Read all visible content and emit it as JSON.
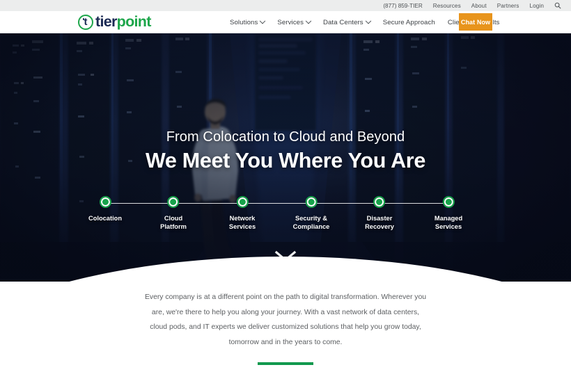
{
  "utility": {
    "phone": "(877) 859-TIER",
    "links": [
      {
        "label": "Resources"
      },
      {
        "label": "About"
      },
      {
        "label": "Partners"
      },
      {
        "label": "Login"
      }
    ],
    "search_icon": "search-icon"
  },
  "brand": {
    "mark_letter": "t",
    "name_part1": "tier",
    "name_part2": "point",
    "green": "#1da64a",
    "navy": "#1b2a54"
  },
  "nav": {
    "items": [
      {
        "label": "Solutions",
        "has_dropdown": true
      },
      {
        "label": "Services",
        "has_dropdown": true
      },
      {
        "label": "Data Centers",
        "has_dropdown": true
      },
      {
        "label": "Secure Approach",
        "has_dropdown": false
      },
      {
        "label": "Clients & Results",
        "has_dropdown": false
      }
    ],
    "cta": {
      "label": "Chat Now",
      "color": "#e8941c"
    }
  },
  "hero": {
    "eyebrow": "From Colocation to Cloud and Beyond",
    "headline": "We Meet You Where You Are",
    "scroll_icon": "chevron-double-down-icon",
    "timeline": {
      "accent": "#17a34a",
      "steps": [
        {
          "label": "Colocation"
        },
        {
          "label": "Cloud\nPlatform"
        },
        {
          "label": "Network\nServices"
        },
        {
          "label": "Security &\nCompliance"
        },
        {
          "label": "Disaster\nRecovery"
        },
        {
          "label": "Managed\nServices"
        }
      ]
    }
  },
  "intro": {
    "paragraph": "Every company is at a different point on the path to digital transformation. Wherever you are, we're there to help you along your journey. With a vast network of data centers, cloud pods, and IT experts we deliver customized solutions that help you grow today, tomorrow and in the years to come.",
    "rule_color": "#12994e"
  }
}
